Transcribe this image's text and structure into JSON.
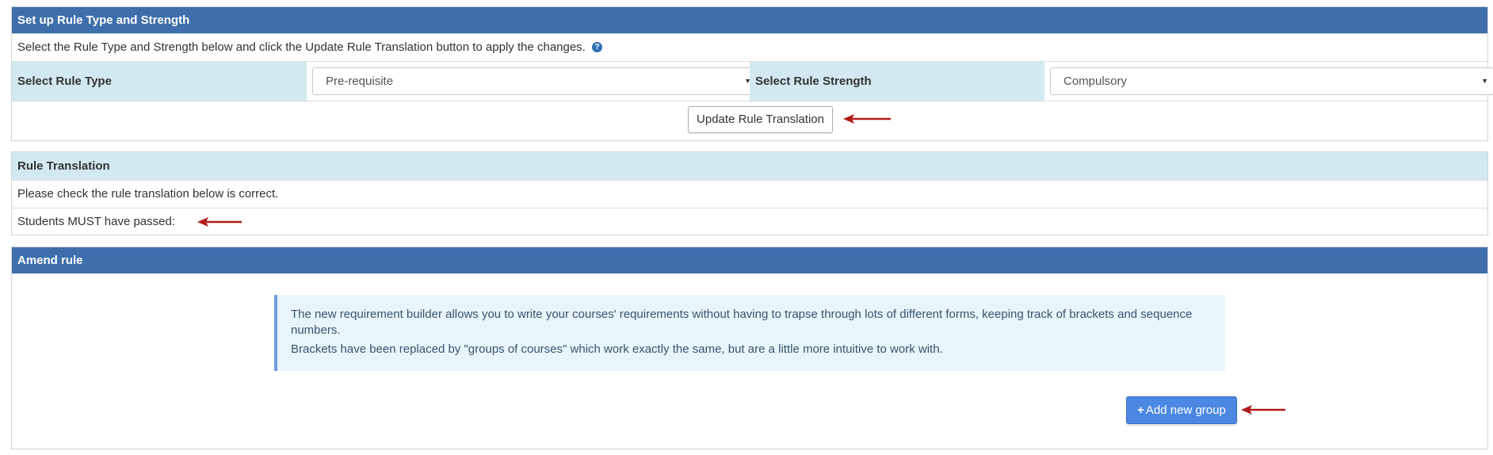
{
  "setup": {
    "title": "Set up Rule Type and Strength",
    "instructions": "Select the Rule Type and Strength below and click the Update Rule Translation button to apply the changes.",
    "help_glyph": "?",
    "rule_type_label": "Select Rule Type",
    "rule_type_value": "Pre-requisite",
    "rule_strength_label": "Select Rule Strength",
    "rule_strength_value": "Compulsory",
    "caret_glyph": "▼",
    "update_button_label": "Update Rule Translation"
  },
  "translation": {
    "title": "Rule Translation",
    "check_text": "Please check the rule translation below is correct.",
    "rule_text": "Students MUST have passed:"
  },
  "amend": {
    "title": "Amend rule",
    "info_line1": "The new requirement builder allows you to write your courses' requirements without having to trapse through lots of different forms, keeping track of brackets and sequence numbers.",
    "info_line2": "Brackets have been replaced by \"groups of courses\" which work exactly the same, but are a little more intuitive to work with.",
    "add_group_icon": "+",
    "add_group_label": "Add new group"
  },
  "colors": {
    "header_blue": "#3e6fac",
    "label_cell_bg": "#d3e9f1",
    "info_bg": "#e8f6fb",
    "primary_button": "#4c88e2",
    "annotation_arrow": "#b31b1b"
  },
  "icons": [
    "help-icon",
    "caret-down-icon",
    "plus-icon",
    "annotation-arrow-icon"
  ]
}
